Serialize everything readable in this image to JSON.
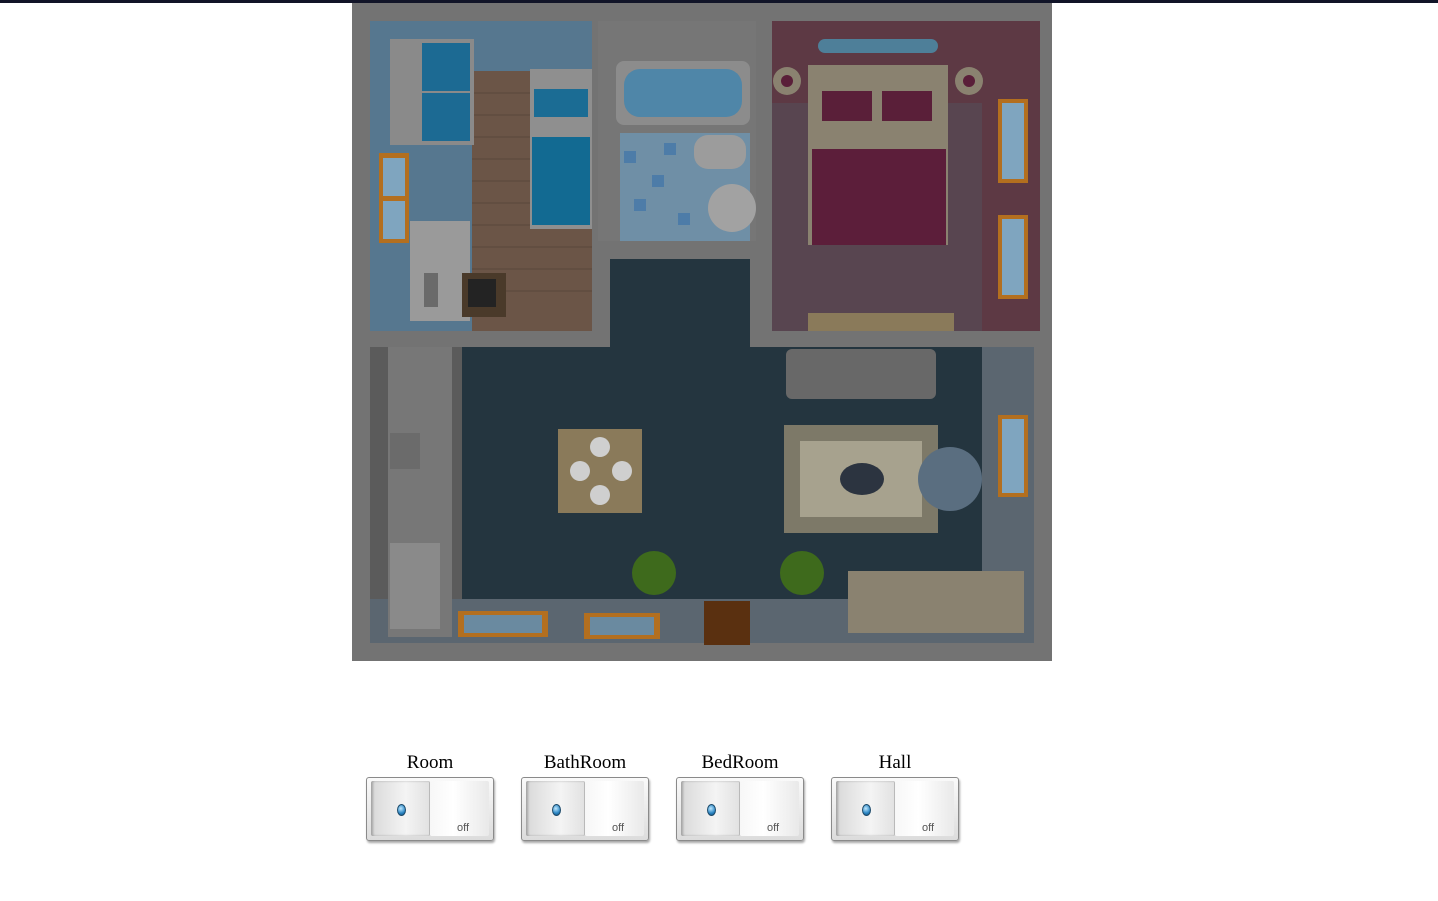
{
  "floorplan": {
    "image_name": "apartment-floorplan-image",
    "rooms": [
      "room",
      "bathroom",
      "bedroom",
      "hall"
    ]
  },
  "switches": [
    {
      "label": "Room",
      "state_text": "off",
      "led_icon": "led-indicator-icon"
    },
    {
      "label": "BathRoom",
      "state_text": "off",
      "led_icon": "led-indicator-icon"
    },
    {
      "label": "BedRoom",
      "state_text": "off",
      "led_icon": "led-indicator-icon"
    },
    {
      "label": "Hall",
      "state_text": "off",
      "led_icon": "led-indicator-icon"
    }
  ],
  "colors": {
    "top_bar": "#111428",
    "wall": "#7a7a7a",
    "room_blue": "#5e7f98",
    "bedroom_purple": "#6b4252",
    "hall_floor": "#24353f",
    "led_blue": "#2b86c4"
  }
}
